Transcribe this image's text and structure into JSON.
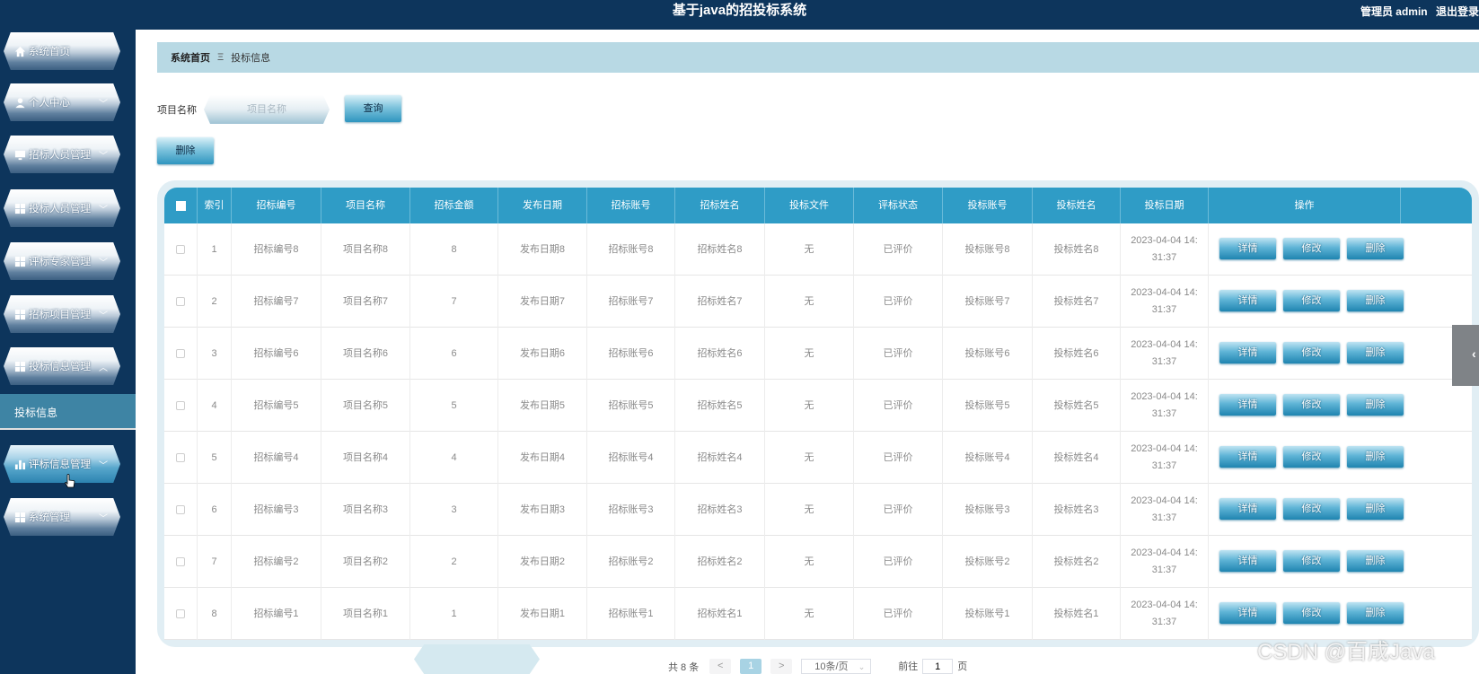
{
  "header": {
    "title": "基于java的招投标系统",
    "role": "管理员 admin",
    "logout": "退出登录"
  },
  "sidebar": {
    "items": [
      {
        "label": "系统首页",
        "icon": "home-icon",
        "caret": false
      },
      {
        "label": "个人中心",
        "icon": "user-icon",
        "caret": true
      },
      {
        "label": "招标人员管理",
        "icon": "monitor-icon",
        "caret": true
      },
      {
        "label": "投标人员管理",
        "icon": "grid-icon",
        "caret": true
      },
      {
        "label": "评标专家管理",
        "icon": "grid-icon",
        "caret": true
      },
      {
        "label": "招标项目管理",
        "icon": "grid-icon",
        "caret": true
      },
      {
        "label": "投标信息管理",
        "icon": "grid-icon",
        "caret": true,
        "expanded": true
      },
      {
        "label": "评标信息管理",
        "icon": "bar-chart-icon",
        "caret": true,
        "hovered": true
      },
      {
        "label": "系统管理",
        "icon": "grid-icon",
        "caret": true
      }
    ],
    "submenu_label": "投标信息"
  },
  "breadcrumb": {
    "home": "系统首页",
    "separator": "Ξ",
    "current": "投标信息"
  },
  "search": {
    "label": "项目名称",
    "placeholder": "项目名称",
    "query_button": "查询"
  },
  "toolbar": {
    "delete_button": "删除"
  },
  "table": {
    "headers": [
      "索引",
      "招标编号",
      "项目名称",
      "招标金额",
      "发布日期",
      "招标账号",
      "招标姓名",
      "投标文件",
      "评标状态",
      "投标账号",
      "投标姓名",
      "投标日期",
      "操作"
    ],
    "rows": [
      {
        "index": "1",
        "bid_no": "招标编号8",
        "project": "项目名称8",
        "amount": "8",
        "pub_date": "发布日期8",
        "bid_account": "招标账号8",
        "bid_name": "招标姓名8",
        "file": "无",
        "status": "已评价",
        "tender_account": "投标账号8",
        "tender_name": "投标姓名8",
        "date1": "2023-04-04 14:",
        "date2": "31:37"
      },
      {
        "index": "2",
        "bid_no": "招标编号7",
        "project": "项目名称7",
        "amount": "7",
        "pub_date": "发布日期7",
        "bid_account": "招标账号7",
        "bid_name": "招标姓名7",
        "file": "无",
        "status": "已评价",
        "tender_account": "投标账号7",
        "tender_name": "投标姓名7",
        "date1": "2023-04-04 14:",
        "date2": "31:37"
      },
      {
        "index": "3",
        "bid_no": "招标编号6",
        "project": "项目名称6",
        "amount": "6",
        "pub_date": "发布日期6",
        "bid_account": "招标账号6",
        "bid_name": "招标姓名6",
        "file": "无",
        "status": "已评价",
        "tender_account": "投标账号6",
        "tender_name": "投标姓名6",
        "date1": "2023-04-04 14:",
        "date2": "31:37"
      },
      {
        "index": "4",
        "bid_no": "招标编号5",
        "project": "项目名称5",
        "amount": "5",
        "pub_date": "发布日期5",
        "bid_account": "招标账号5",
        "bid_name": "招标姓名5",
        "file": "无",
        "status": "已评价",
        "tender_account": "投标账号5",
        "tender_name": "投标姓名5",
        "date1": "2023-04-04 14:",
        "date2": "31:37"
      },
      {
        "index": "5",
        "bid_no": "招标编号4",
        "project": "项目名称4",
        "amount": "4",
        "pub_date": "发布日期4",
        "bid_account": "招标账号4",
        "bid_name": "招标姓名4",
        "file": "无",
        "status": "已评价",
        "tender_account": "投标账号4",
        "tender_name": "投标姓名4",
        "date1": "2023-04-04 14:",
        "date2": "31:37"
      },
      {
        "index": "6",
        "bid_no": "招标编号3",
        "project": "项目名称3",
        "amount": "3",
        "pub_date": "发布日期3",
        "bid_account": "招标账号3",
        "bid_name": "招标姓名3",
        "file": "无",
        "status": "已评价",
        "tender_account": "投标账号3",
        "tender_name": "投标姓名3",
        "date1": "2023-04-04 14:",
        "date2": "31:37"
      },
      {
        "index": "7",
        "bid_no": "招标编号2",
        "project": "项目名称2",
        "amount": "2",
        "pub_date": "发布日期2",
        "bid_account": "招标账号2",
        "bid_name": "招标姓名2",
        "file": "无",
        "status": "已评价",
        "tender_account": "投标账号2",
        "tender_name": "投标姓名2",
        "date1": "2023-04-04 14:",
        "date2": "31:37"
      },
      {
        "index": "8",
        "bid_no": "招标编号1",
        "project": "项目名称1",
        "amount": "1",
        "pub_date": "发布日期1",
        "bid_account": "招标账号1",
        "bid_name": "招标姓名1",
        "file": "无",
        "status": "已评价",
        "tender_account": "投标账号1",
        "tender_name": "投标姓名1",
        "date1": "2023-04-04 14:",
        "date2": "31:37"
      }
    ],
    "actions": {
      "detail": "详情",
      "edit": "修改",
      "delete": "删除"
    }
  },
  "pagination": {
    "total": "共 8 条",
    "prev": "<",
    "current_page": "1",
    "next": ">",
    "page_size": "10条/页",
    "goto_prefix": "前往",
    "goto_value": "1",
    "goto_suffix": "页"
  },
  "watermark": "CSDN @百成Java",
  "colors": {
    "sidebar_bg": "#0d355c",
    "accent": "#2f9cc6",
    "breadcrumb_bg": "#b8d9e4"
  }
}
